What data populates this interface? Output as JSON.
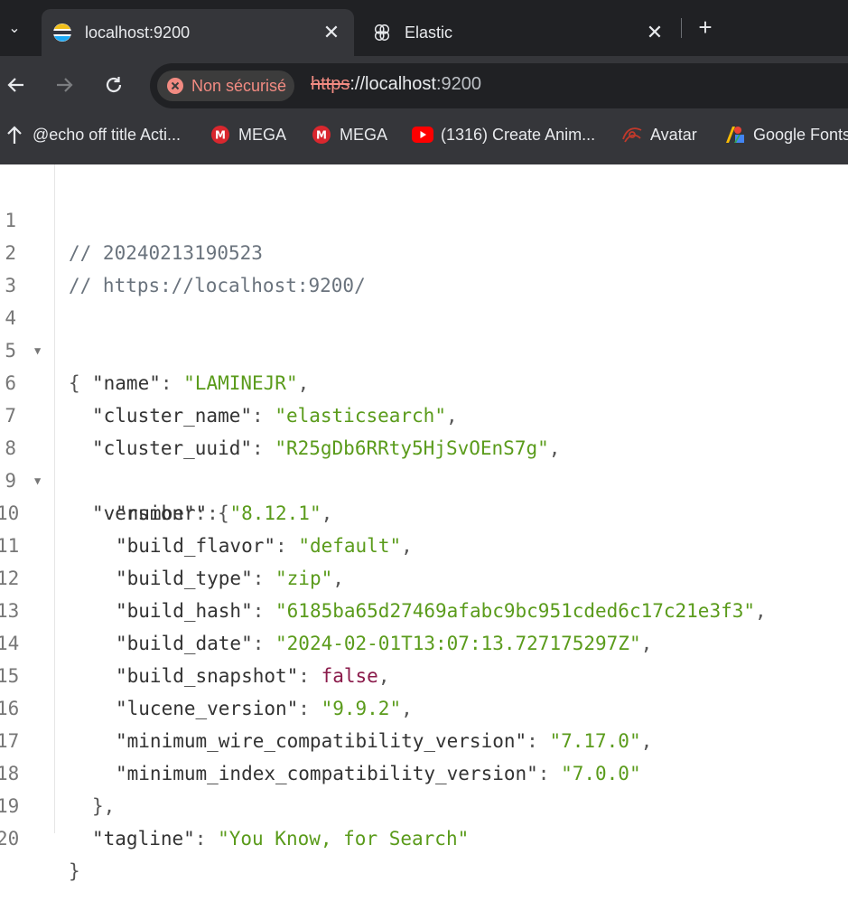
{
  "browser": {
    "tabs": [
      {
        "title": "localhost:9200",
        "favicon": "elasticsearch-logo-icon",
        "active": true
      },
      {
        "title": "Elastic",
        "favicon": "elastic-cluster-icon",
        "active": false
      }
    ],
    "tab_close_glyph": "✕",
    "new_tab_glyph": "+",
    "tab_menu_glyph": "⌄",
    "security_label": "Non sécurisé",
    "url": {
      "scheme": "https",
      "separator": "://",
      "host": "localhost",
      "port": ":9200"
    },
    "bookmarks": [
      {
        "label": "@echo off title Acti...",
        "icon": "up-arrow-icon"
      },
      {
        "label": "MEGA",
        "icon": "mega-icon"
      },
      {
        "label": "MEGA",
        "icon": "mega-icon"
      },
      {
        "label": "(1316) Create Anim...",
        "icon": "youtube-icon"
      },
      {
        "label": "Avatar",
        "icon": "avatar-icon"
      },
      {
        "label": "Google Fonts",
        "icon": "google-fonts-icon"
      }
    ]
  },
  "viewer": {
    "comment_timestamp": "// 20240213190523",
    "comment_url": "// https://localhost:9200/",
    "open_brace": "{",
    "close_brace": "}",
    "version_close": "},",
    "fields": {
      "name": {
        "key": "\"name\"",
        "value": "\"LAMINEJR\""
      },
      "cluster_name": {
        "key": "\"cluster_name\"",
        "value": "\"elasticsearch\""
      },
      "cluster_uuid": {
        "key": "\"cluster_uuid\"",
        "value": "\"R25gDb6RRty5HjSvOEnS7g\""
      },
      "version": {
        "key": "\"version\"",
        "value": "{"
      },
      "number": {
        "key": "\"number\"",
        "value": "\"8.12.1\""
      },
      "build_flavor": {
        "key": "\"build_flavor\"",
        "value": "\"default\""
      },
      "build_type": {
        "key": "\"build_type\"",
        "value": "\"zip\""
      },
      "build_hash": {
        "key": "\"build_hash\"",
        "value": "\"6185ba65d27469afabc9bc951cded6c17c21e3f3\""
      },
      "build_date": {
        "key": "\"build_date\"",
        "value": "\"2024-02-01T13:07:13.727175297Z\""
      },
      "build_snapshot": {
        "key": "\"build_snapshot\"",
        "value": "false"
      },
      "lucene_version": {
        "key": "\"lucene_version\"",
        "value": "\"9.9.2\""
      },
      "minimum_wire_compatibility_version": {
        "key": "\"minimum_wire_compatibility_version\"",
        "value": "\"7.17.0\""
      },
      "minimum_index_compatibility_version": {
        "key": "\"minimum_index_compatibility_version\"",
        "value": "\"7.0.0\""
      },
      "tagline": {
        "key": "\"tagline\"",
        "value": "\"You Know, for Search\""
      }
    },
    "line_numbers": [
      "1",
      "2",
      "3",
      "4",
      "5",
      "6",
      "7",
      "8",
      "9",
      "10",
      "11",
      "12",
      "13",
      "14",
      "15",
      "16",
      "17",
      "18",
      "19",
      "20"
    ],
    "fold_glyph": "▼",
    "colon": ": ",
    "comma": ","
  }
}
